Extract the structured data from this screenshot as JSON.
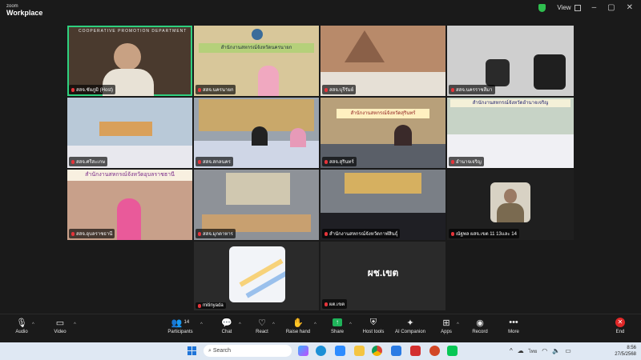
{
  "app": {
    "logo_line1": "zoom",
    "logo_line2": "Workplace",
    "view_label": "View",
    "colors": {
      "accent_active": "#2fd07f",
      "end_red": "#e02828",
      "shield_green": "#2fbf4f"
    }
  },
  "tiles": [
    {
      "name": "สสจ.ชัยภูมิ (Host)",
      "banner": "COOPERATIVE PROMOTION DEPARTMENT",
      "bg": "#4a3a2e"
    },
    {
      "name": "สสจ.นครนายก",
      "banner": "สำนักงานสหกรณ์จังหวัดนครนายก",
      "bg": "#d8c79a"
    },
    {
      "name": "สสจ.บุรีรัมย์",
      "banner": "",
      "bg": "#b88a6a"
    },
    {
      "name": "สสจ.นครราชสีมา",
      "banner": "",
      "bg": "#cfcfcf"
    },
    {
      "name": "สสจ.ศรีสะเกษ",
      "banner": "",
      "bg": "#b9c9d8"
    },
    {
      "name": "สสจ.สกลนคร",
      "banner": "",
      "bg": "#9aa3ad"
    },
    {
      "name": "สสจ.สุรินทร์",
      "banner": "สำนักงานสหกรณ์จังหวัดสุรินทร์",
      "bg": "#b8a07a"
    },
    {
      "name": "อำนาจเจริญ",
      "banner": "สำนักงานสหกรณ์จังหวัดอำนาจเจริญ",
      "bg": "#c7d3c6"
    },
    {
      "name": "สสจ.อุบลราชธานี",
      "banner": "สำนักงานสหกรณ์จังหวัดอุบลราชธานี",
      "bg": "#c8a08a"
    },
    {
      "name": "สสจ.มุกดาหาร",
      "banner": "",
      "bg": "#8e9298"
    },
    {
      "name": "สำนักงานสหกรณ์จังหวัดกาฬสินธุ์",
      "banner": "",
      "bg": "#7a7f86"
    },
    {
      "name": "ณัฐพล ผสจ.เขต 11 13และ 14",
      "banner": "",
      "bg": "#1f1f1f"
    },
    {
      "name": "mitinyada",
      "banner": "",
      "bg": "#2a2a2a"
    },
    {
      "name": "ผต.เขต",
      "banner": "ผช.เขต",
      "bg": "#2a2a2a"
    }
  ],
  "toolbar": {
    "audio": "Audio",
    "video": "Video",
    "participants": "Participants",
    "participants_count": "14",
    "chat": "Chat",
    "react": "React",
    "raise_hand": "Raise hand",
    "share": "Share",
    "host_tools": "Host tools",
    "ai_companion": "AI Companion",
    "apps": "Apps",
    "record": "Record",
    "more": "More",
    "end": "End"
  },
  "taskbar": {
    "search_placeholder": "Search",
    "lang": "ไทย",
    "time": "8:56",
    "date": "27/5/2568"
  }
}
